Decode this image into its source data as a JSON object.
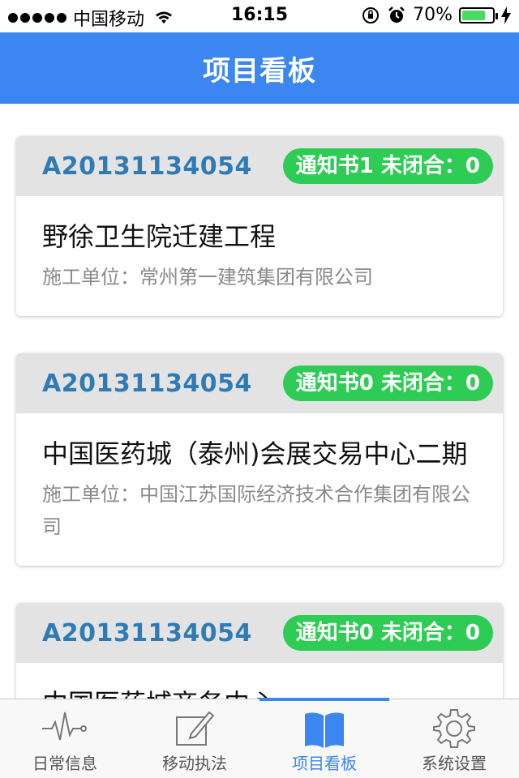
{
  "status_bar": {
    "carrier": "中国移动",
    "time": "16:15",
    "battery_percent": "70%",
    "battery_level": 0.7
  },
  "nav": {
    "title": "项目看板"
  },
  "cards": [
    {
      "code": "A20131134054",
      "badge": "通知书1 未闭合：0",
      "title": "野徐卫生院迁建工程",
      "unit": "施工单位：常州第一建筑集团有限公司"
    },
    {
      "code": "A20131134054",
      "badge": "通知书0 未闭合：0",
      "title": "中国医药城（泰州)会展交易中心二期",
      "unit": "施工单位：中国江苏国际经济技术合作集团有限公司"
    },
    {
      "code": "A20131134054",
      "badge": "通知书0 未闭合：0",
      "title": "中国医药城商务中心",
      "unit": ""
    }
  ],
  "tabs": [
    {
      "label": "日常信息",
      "icon": "pulse-icon"
    },
    {
      "label": "移动执法",
      "icon": "edit-icon"
    },
    {
      "label": "项目看板",
      "icon": "book-icon",
      "active": true
    },
    {
      "label": "系统设置",
      "icon": "gear-icon"
    }
  ],
  "colors": {
    "accent": "#3b86f0",
    "badge": "#2ecc55",
    "code_text": "#2f7bb6",
    "card_header": "#e3e3e3"
  }
}
